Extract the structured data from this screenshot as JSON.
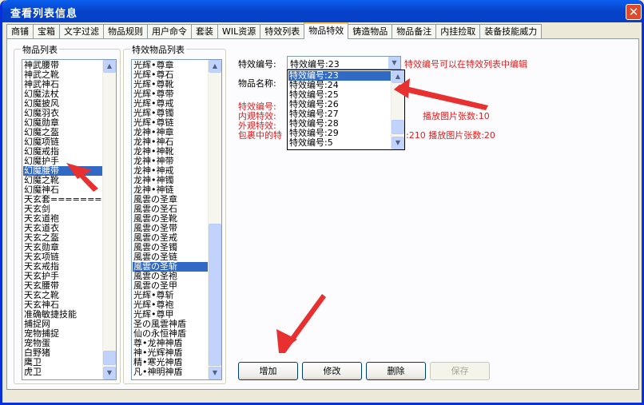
{
  "window": {
    "title": "查看列表信息",
    "close_icon": "✕"
  },
  "tabs": [
    "商铺",
    "宝箱",
    "文字过滤",
    "物品规则",
    "用户命令",
    "套装",
    "WIL资源",
    "特效列表",
    "物品特效",
    "铸造物品",
    "物品备注",
    "内挂捡取",
    "装备技能威力"
  ],
  "active_tab": 8,
  "item_list": {
    "label": "物品列表",
    "items": [
      "神武腰带",
      "神武之靴",
      "神武神石",
      "幻魔法杖",
      "幻魔披风",
      "幻魔羽衣",
      "幻魔勋章",
      "幻魔之盔",
      "幻魔项链",
      "幻魔戒指",
      "幻魔护手",
      "幻魔腰带",
      "幻魔之靴",
      "幻魔神石",
      "天玄套========",
      "天玄剑",
      "天玄道袍",
      "天玄道衣",
      "天玄之盔",
      "天玄勋章",
      "天玄项链",
      "天玄戒指",
      "天玄护手",
      "天玄腰带",
      "天玄之靴",
      "天玄神石",
      "准确敏捷技能",
      "捕捉网",
      "宠物捕捉",
      "宠物蛋",
      "白野猪",
      "鹰卫",
      "虎卫"
    ],
    "selected_index": 11
  },
  "effect_list": {
    "label": "特效物品列表",
    "items": [
      "光辉•尊章",
      "光辉•尊石",
      "光辉•尊靴",
      "光辉•尊带",
      "光辉•尊戒",
      "光辉•尊镯",
      "光辉•尊链",
      "龙神•神章",
      "龙神•神石",
      "龙神•神靴",
      "龙神•神带",
      "龙神•神戒",
      "龙神•神镯",
      "龙神•神链",
      "風雲の圣章",
      "風雲の圣石",
      "風雲の圣靴",
      "風雲の圣带",
      "風雲の圣戒",
      "風雲の圣镯",
      "風雲の圣链",
      "風雲の圣斩",
      "風雲の圣袍",
      "風雲の圣甲",
      "光辉•尊斩",
      "光辉•尊袍",
      "光辉•尊甲",
      "圣の風雲神盾",
      "仙の永恒神盾",
      "尊•龙神神盾",
      "神•光辉神盾",
      "精•寒光神盾",
      "凡•神明神盾"
    ],
    "selected_index": 21
  },
  "form": {
    "effect_no_label": "特效编号:",
    "effect_no_value": "特效编号:23",
    "effect_hint": "特效编号可以在特效列表中编辑",
    "item_name_label": "物品名称:",
    "info_lines": [
      "特效编号:",
      "内观特效:",
      "外观特效:",
      "包裹中的特"
    ],
    "play1": "播放图片张数:10",
    "play2": ":210  播放图片张数:20"
  },
  "dropdown": {
    "items": [
      "特效编号:23",
      "特效编号:24",
      "特效编号:25",
      "特效编号:26",
      "特效编号:27",
      "特效编号:28",
      "特效编号:29",
      "特效编号:5"
    ],
    "selected_index": 0
  },
  "buttons": {
    "add": "增加",
    "edit": "修改",
    "delete": "删除",
    "save": "保存"
  },
  "icons": {
    "up": "▲",
    "down": "▼"
  },
  "colors": {
    "selection": "#316AC5",
    "hint_red": "#E02020",
    "arrow_red": "#E83030"
  }
}
